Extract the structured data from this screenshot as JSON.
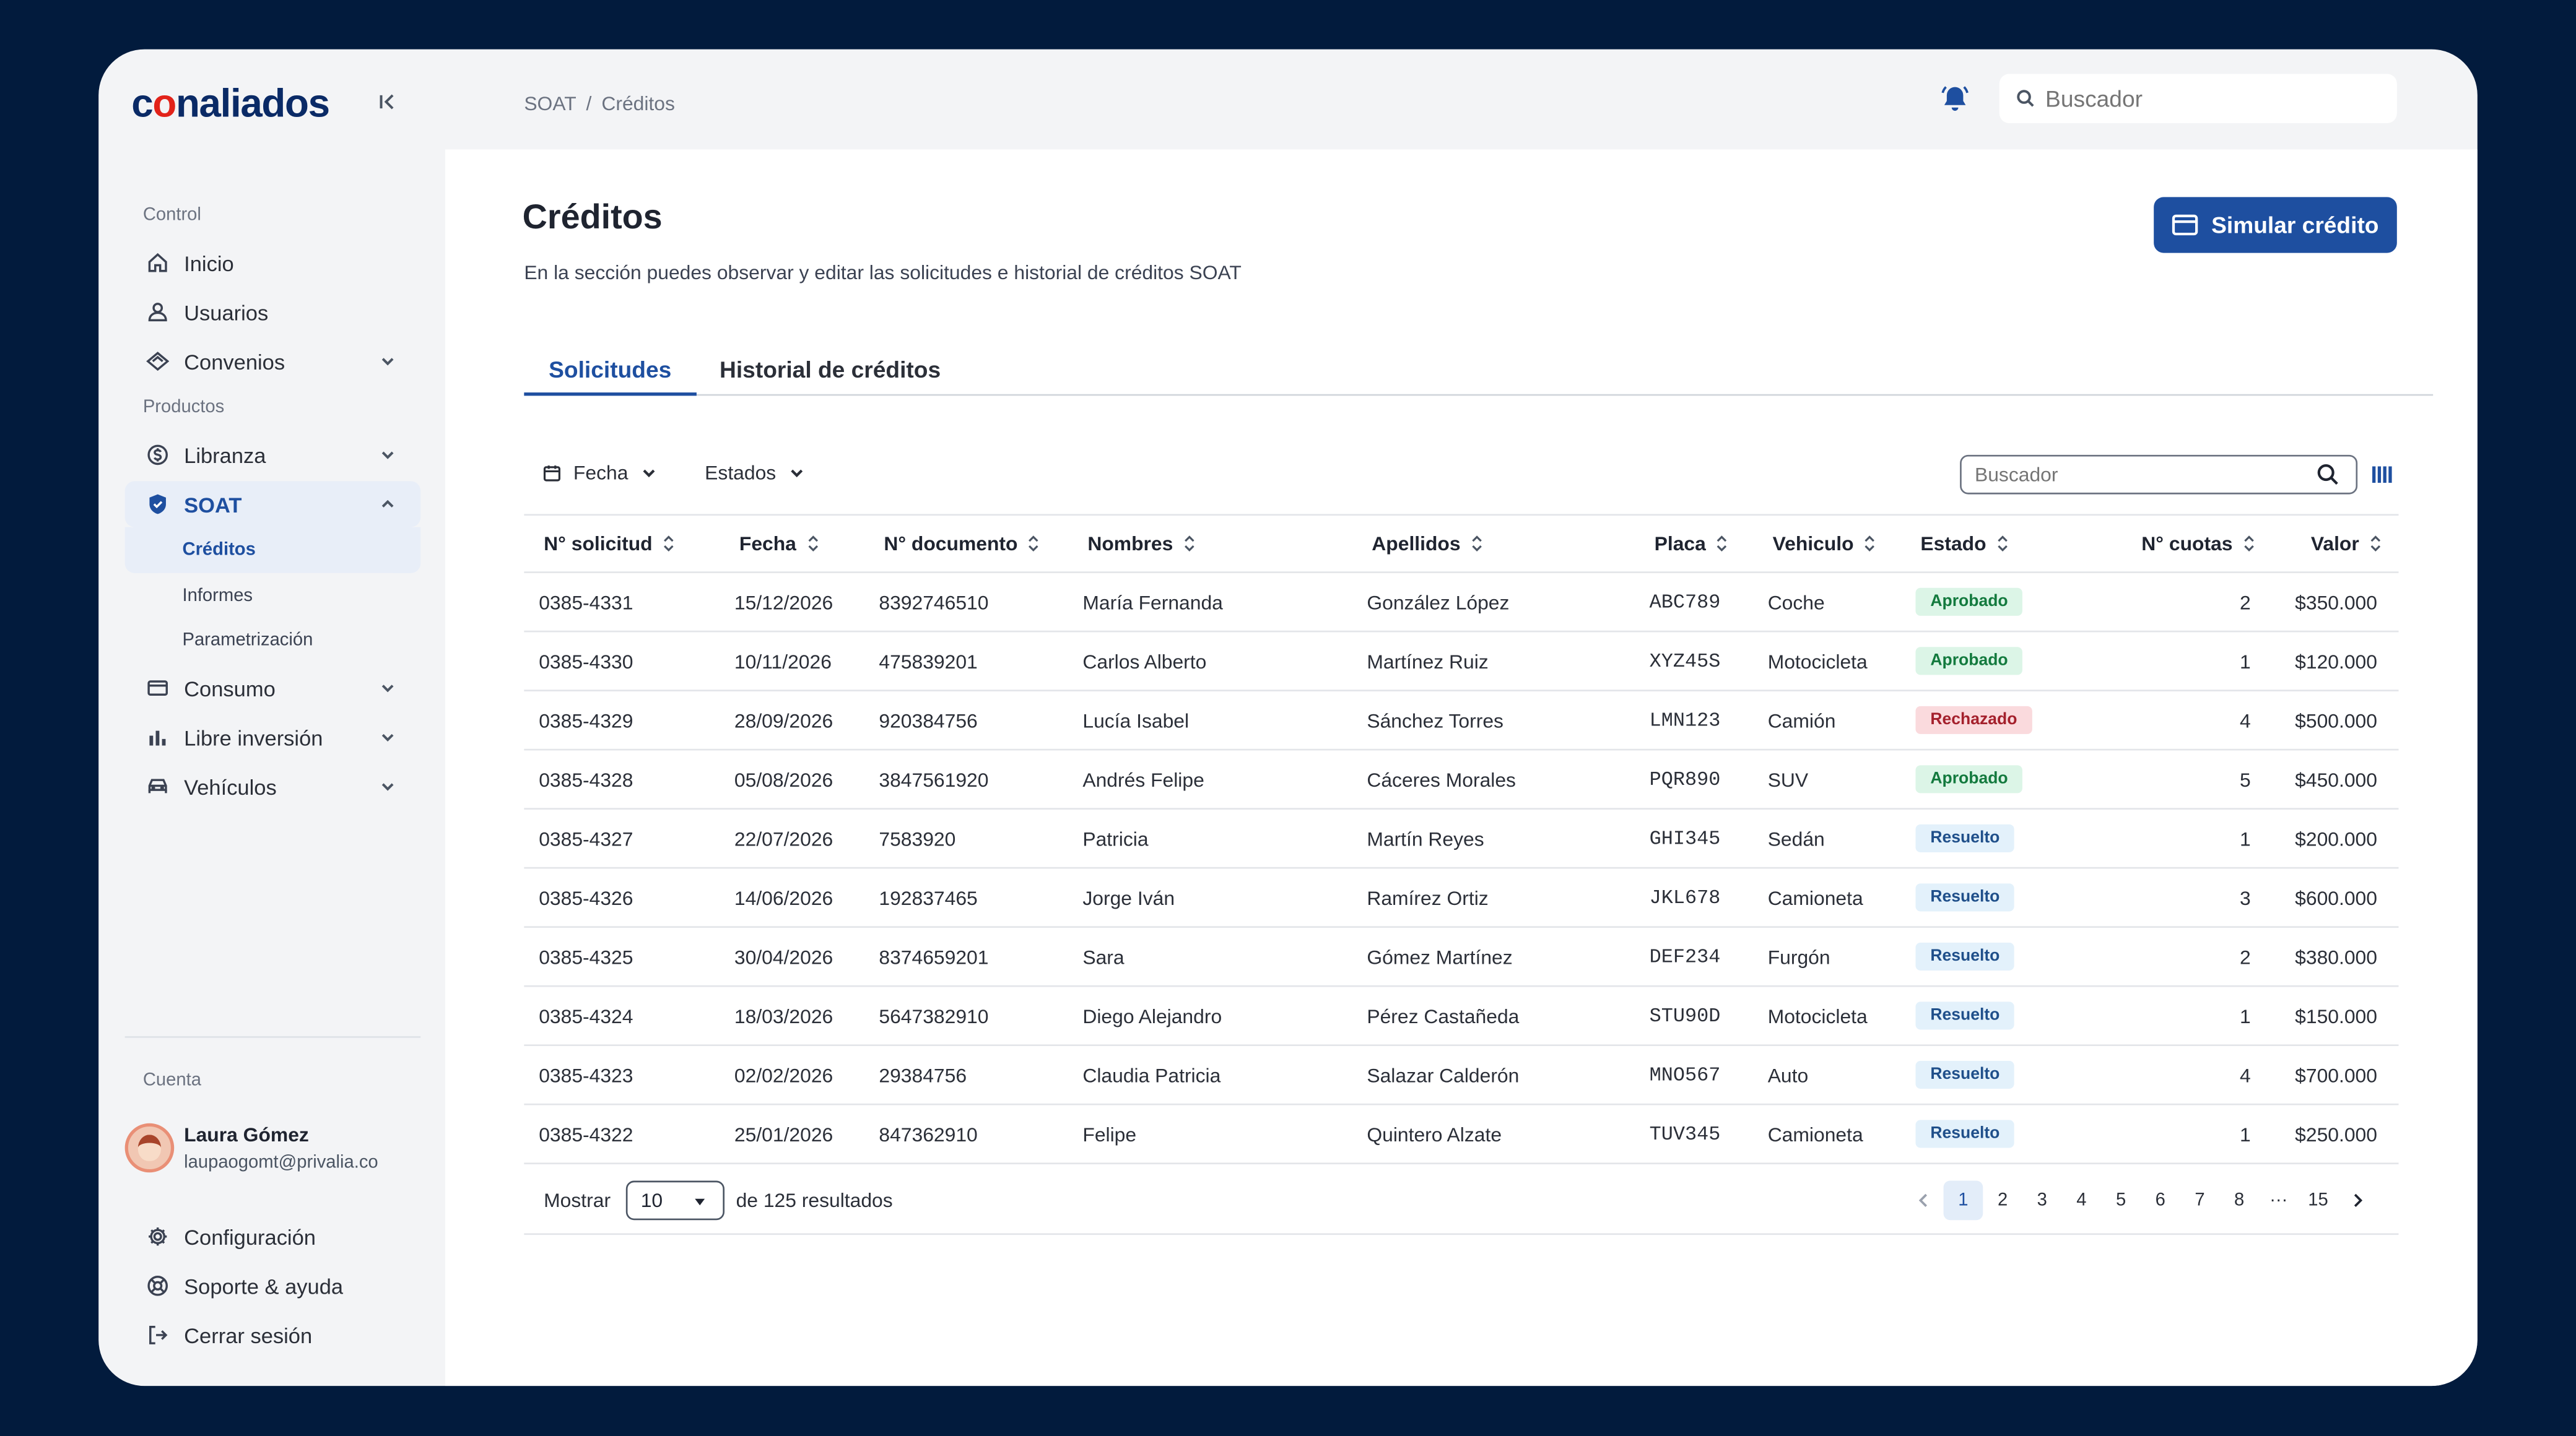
{
  "brand": {
    "logo_prefix": "c",
    "logo_accent": "o",
    "logo_suffix": "naliados"
  },
  "sidebar": {
    "section_control": "Control",
    "section_products": "Productos",
    "section_account": "Cuenta",
    "items": {
      "inicio": "Inicio",
      "usuarios": "Usuarios",
      "convenios": "Convenios",
      "libranza": "Libranza",
      "soat": "SOAT",
      "creditos": "Créditos",
      "informes": "Informes",
      "parametrizacion": "Parametrización",
      "consumo": "Consumo",
      "libre_inversion": "Libre inversión",
      "vehiculos": "Vehículos"
    },
    "user": {
      "name": "Laura Gómez",
      "email": "laupaogomt@privalia.co"
    },
    "account_items": {
      "configuracion": "Configuración",
      "soporte": "Soporte & ayuda",
      "cerrar": "Cerrar sesión"
    }
  },
  "topbar": {
    "breadcrumb": [
      "SOAT",
      "/",
      "Créditos"
    ],
    "search_placeholder": "Buscador"
  },
  "main": {
    "title": "Créditos",
    "description": "En la sección puedes observar y editar las solicitudes e historial de créditos SOAT",
    "primary_button": "Simular crédito",
    "tabs": [
      {
        "label": "Solicitudes",
        "active": true
      },
      {
        "label": "Historial de créditos",
        "active": false
      }
    ],
    "filters": {
      "fecha": "Fecha",
      "estados": "Estados"
    },
    "table_search_placeholder": "Buscador"
  },
  "table": {
    "columns": [
      "N° solicitud",
      "Fecha",
      "N° documento",
      "Nombres",
      "Apellidos",
      "Placa",
      "Vehiculo",
      "Estado",
      "N° cuotas",
      "Valor"
    ],
    "rows": [
      [
        "0385-4331",
        "15/12/2026",
        "8392746510",
        "María Fernanda",
        "González López",
        "ABC789",
        "Coche",
        "Aprobado",
        "2",
        "$350.000"
      ],
      [
        "0385-4330",
        "10/11/2026",
        "475839201",
        "Carlos Alberto",
        "Martínez Ruiz",
        "XYZ45S",
        "Motocicleta",
        "Aprobado",
        "1",
        "$120.000"
      ],
      [
        "0385-4329",
        "28/09/2026",
        "920384756",
        "Lucía Isabel",
        "Sánchez Torres",
        "LMN123",
        "Camión",
        "Rechazado",
        "4",
        "$500.000"
      ],
      [
        "0385-4328",
        "05/08/2026",
        "3847561920",
        "Andrés Felipe",
        "Cáceres Morales",
        "PQR890",
        "SUV",
        "Aprobado",
        "5",
        "$450.000"
      ],
      [
        "0385-4327",
        "22/07/2026",
        "7583920",
        "Patricia",
        "Martín Reyes",
        "GHI345",
        "Sedán",
        "Resuelto",
        "1",
        "$200.000"
      ],
      [
        "0385-4326",
        "14/06/2026",
        "192837465",
        "Jorge Iván",
        "Ramírez Ortiz",
        "JKL678",
        "Camioneta",
        "Resuelto",
        "3",
        "$600.000"
      ],
      [
        "0385-4325",
        "30/04/2026",
        "8374659201",
        "Sara",
        "Gómez Martínez",
        "DEF234",
        "Furgón",
        "Resuelto",
        "2",
        "$380.000"
      ],
      [
        "0385-4324",
        "18/03/2026",
        "5647382910",
        "Diego Alejandro",
        "Pérez Castañeda",
        "STU90D",
        "Motocicleta",
        "Resuelto",
        "1",
        "$150.000"
      ],
      [
        "0385-4323",
        "02/02/2026",
        "29384756",
        "Claudia Patricia",
        "Salazar Calderón",
        "MNO567",
        "Auto",
        "Resuelto",
        "4",
        "$700.000"
      ],
      [
        "0385-4322",
        "25/01/2026",
        "847362910",
        "Felipe",
        "Quintero Alzate",
        "TUV345",
        "Camioneta",
        "Resuelto",
        "1",
        "$250.000"
      ]
    ],
    "status_colors": {
      "Aprobado": "#137a3e",
      "Rechazado": "#a4202c",
      "Resuelto": "#1f4f8a"
    }
  },
  "pagination": {
    "show_label": "Mostrar",
    "page_size": "10",
    "results_text": "de 125 resultados",
    "pages": [
      "1",
      "2",
      "3",
      "4",
      "5",
      "6",
      "7",
      "8",
      "···",
      "15"
    ],
    "current": "1"
  },
  "colors": {
    "accent": "#1e4fa0",
    "background": "#021b3d",
    "logo_accent": "#e2231a"
  }
}
